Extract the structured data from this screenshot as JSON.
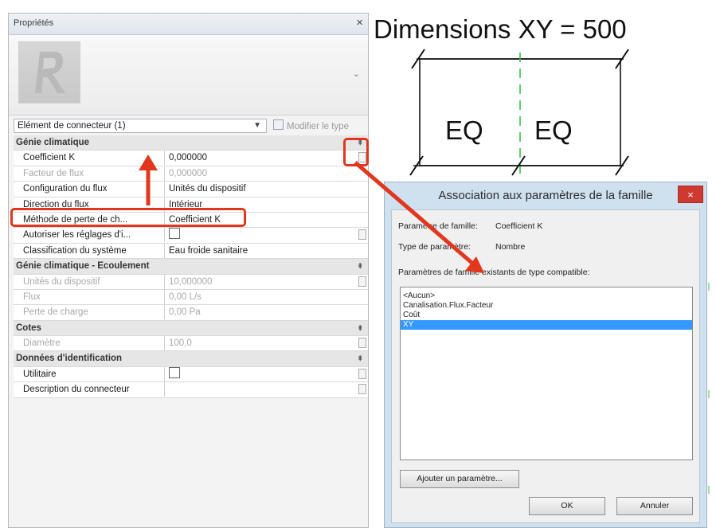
{
  "properties_panel": {
    "title": "Propriétés",
    "close_glyph": "×",
    "type_selector_chevron": "⌄",
    "element_selector": "Elément de connecteur (1)",
    "modify_type_label": "Modifier le type",
    "categories": [
      {
        "label": "Génie climatique",
        "rows": [
          {
            "label": "Coefficient K",
            "value": "0,000000",
            "disabled": false,
            "assoc": true
          },
          {
            "label": "Facteur de flux",
            "value": "0,000000",
            "disabled": true,
            "assoc": false
          },
          {
            "label": "Configuration du flux",
            "value": "Unités du dispositif",
            "disabled": false,
            "assoc": false
          },
          {
            "label": "Direction du flux",
            "value": "Intérieur",
            "disabled": false,
            "assoc": false
          },
          {
            "label": "Méthode de perte de ch...",
            "value": "Coefficient K",
            "disabled": false,
            "assoc": false
          },
          {
            "label": "Autoriser les réglages d'i...",
            "value": "",
            "checkbox": true,
            "disabled": false,
            "assoc": true
          },
          {
            "label": "Classification du système",
            "value": "Eau froide sanitaire",
            "disabled": false,
            "assoc": false
          }
        ]
      },
      {
        "label": "Génie climatique - Ecoulement",
        "rows": [
          {
            "label": "Unités du dispositif",
            "value": "10,000000",
            "disabled": true,
            "assoc": true
          },
          {
            "label": "Flux",
            "value": "0,00 L/s",
            "disabled": true,
            "assoc": false
          },
          {
            "label": "Perte de charge",
            "value": "0,00 Pa",
            "disabled": true,
            "assoc": false
          }
        ]
      },
      {
        "label": "Cotes",
        "rows": [
          {
            "label": "Diamètre",
            "value": "100,0",
            "disabled": true,
            "assoc": true
          }
        ]
      },
      {
        "label": "Données d'identification",
        "rows": [
          {
            "label": "Utilitaire",
            "value": "",
            "checkbox": true,
            "disabled": false,
            "assoc": true
          },
          {
            "label": "Description du connecteur",
            "value": "",
            "disabled": false,
            "assoc": true
          }
        ]
      }
    ],
    "collapse_glyph": "⇞"
  },
  "drawing": {
    "title": "Dimensions XY = 500",
    "eq_left": "EQ",
    "eq_right": "EQ"
  },
  "dialog": {
    "title": "Association aux paramètres de la famille",
    "close_glyph": "×",
    "family_param_label": "Paramètre de famille:",
    "family_param_value": "Coefficient K",
    "param_type_label": "Type de paramètre:",
    "param_type_value": "Nombre",
    "existing_label": "Paramètres de famille existants de type compatible:",
    "list_items": [
      "<Aucun>",
      "Canalisation.Flux.Facteur",
      "Coût",
      "XY"
    ],
    "selected_item": "XY",
    "add_param_button": "Ajouter un paramètre...",
    "ok_button": "OK",
    "cancel_button": "Annuler"
  },
  "colors": {
    "annotation_red": "#e2361d",
    "dialog_close_red": "#cf3a30",
    "list_selection": "#3399ff",
    "centerline_green": "#3fbf4a"
  }
}
